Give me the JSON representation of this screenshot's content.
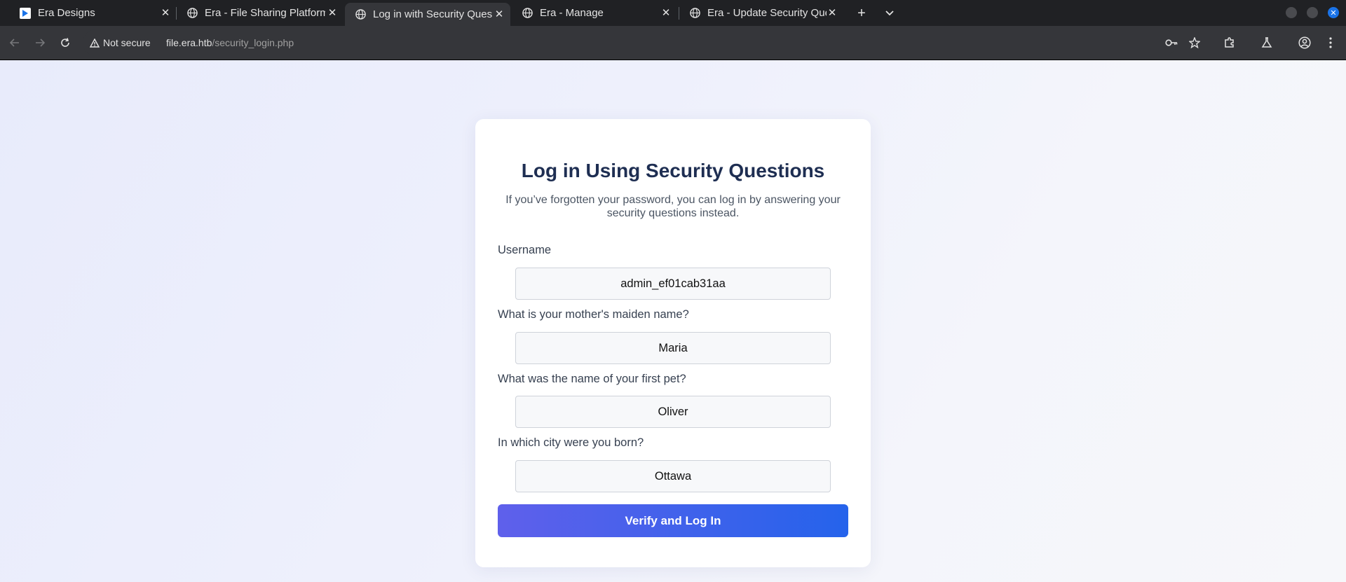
{
  "browser": {
    "tabs": [
      {
        "title": "Era Designs",
        "icon": "era-designs-favicon",
        "active": false
      },
      {
        "title": "Era - File Sharing Platform",
        "icon": "globe-icon",
        "active": false
      },
      {
        "title": "Log in with Security Questions",
        "icon": "globe-icon",
        "active": true
      },
      {
        "title": "Era - Manage",
        "icon": "globe-icon",
        "active": false
      },
      {
        "title": "Era - Update Security Questions",
        "icon": "globe-icon",
        "active": false
      }
    ],
    "security_label": "Not secure",
    "url_host": "file.era.htb",
    "url_path": "/security_login.php"
  },
  "page": {
    "title": "Log in Using Security Questions",
    "subtitle": "If you’ve forgotten your password, you can log in by answering your security questions instead.",
    "fields": [
      {
        "label": "Username",
        "value": "admin_ef01cab31aa"
      },
      {
        "label": "What is your mother's maiden name?",
        "value": "Maria"
      },
      {
        "label": "What was the name of your first pet?",
        "value": "Oliver"
      },
      {
        "label": "In which city were you born?",
        "value": "Ottawa"
      }
    ],
    "submit_label": "Verify and Log In"
  },
  "colors": {
    "tabstrip_bg": "#202124",
    "toolbar_bg": "#35363a",
    "title_color": "#1e2e52",
    "button_gradient_start": "#5f60eb",
    "button_gradient_end": "#2563eb"
  }
}
